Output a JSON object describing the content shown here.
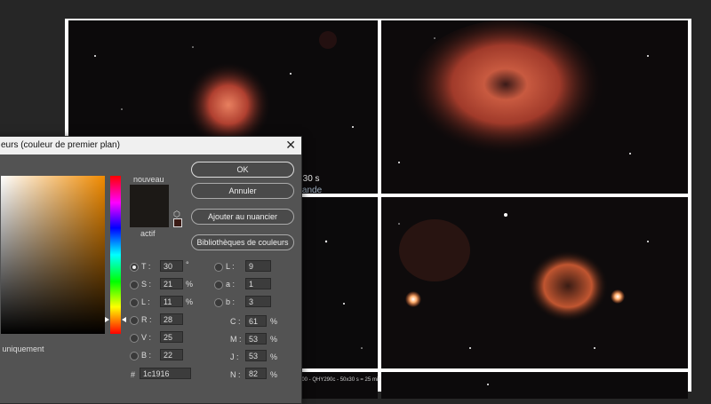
{
  "caption": {
    "line1": "Nebula | 19 min 30 s",
    "line2": "15s | 70 | Duo-Bande"
  },
  "strip_text": "200 - QHY290c - 50x30 s = 25 min",
  "dialog": {
    "title": "eurs (couleur de premier plan)",
    "new_label": "nouveau",
    "current_label": "actif",
    "buttons": {
      "ok": "OK",
      "cancel": "Annuler",
      "add_swatch": "Ajouter au nuancier",
      "libraries": "Bibliothèques de couleurs"
    },
    "web_only": "b uniquement",
    "hsb": {
      "h_label": "T :",
      "h": "30",
      "h_unit": "°",
      "s_label": "S :",
      "s": "21",
      "s_unit": "%",
      "b_label": "L :",
      "b": "11",
      "b_unit": "%"
    },
    "rgb": {
      "r_label": "R :",
      "r": "28",
      "g_label": "V :",
      "g": "25",
      "b_label": "B :",
      "b": "22"
    },
    "lab": {
      "l_label": "L :",
      "l": "9",
      "a_label": "a :",
      "a": "1",
      "b_label": "b :",
      "b": "3"
    },
    "cmyk": {
      "c_label": "C :",
      "c": "61",
      "m_label": "M :",
      "m": "53",
      "y_label": "J :",
      "y": "53",
      "k_label": "N :",
      "k": "82",
      "unit": "%"
    },
    "hex_label": "#",
    "hex": "1c1916",
    "close_icon": "close-icon",
    "cube_icon": "cube-icon",
    "colors": {
      "new": "#1c1916",
      "current": "#1c1916",
      "field_hue": "#f08a00"
    }
  }
}
